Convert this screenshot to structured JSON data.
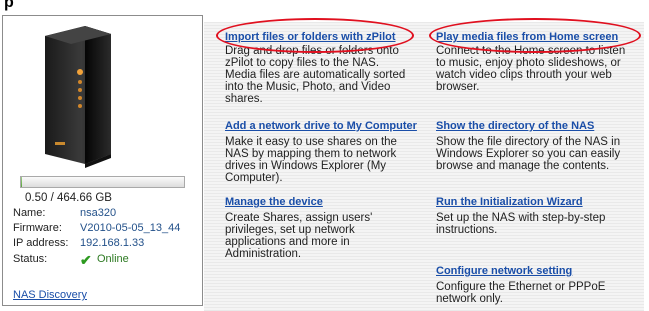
{
  "top_label": "p",
  "device": {
    "storage_text": "0.50 / 464.66 GB",
    "storage_used_fraction": 0.0011,
    "info": [
      {
        "label": "Name:",
        "value": "nsa320"
      },
      {
        "label": "Firmware:",
        "value": "V2010-05-05_13_44"
      },
      {
        "label": "IP address:",
        "value": "192.168.1.33"
      },
      {
        "label": "Status:",
        "value": "Online"
      }
    ],
    "discovery_link": "NAS Discovery"
  },
  "actions": {
    "import": {
      "title": "Import files or folders with zPilot",
      "desc": "Drag and drop files or folders onto zPilot to copy files to the NAS. Media files are automatically sorted into the Music, Photo, and Video shares."
    },
    "add_drive": {
      "title": "Add a network drive to My Computer",
      "desc": "Make it easy to use shares on the NAS by mapping them to network drives in Windows Explorer (My Computer)."
    },
    "manage": {
      "title": "Manage the device",
      "desc": "Create Shares, assign users' privileges, set up network applications and more in Administration."
    },
    "play_media": {
      "title": "Play media files from Home screen",
      "desc": "Connect to the Home screen to listen to music, enjoy photo slideshows, or watch video clips throuth your web browser."
    },
    "show_dir": {
      "title": "Show the directory of the NAS",
      "desc": "Show the file directory of the NAS in Windows Explorer so you can easily browse and manage the contents."
    },
    "wizard": {
      "title": "Run the Initialization Wizard",
      "desc": "Set up the NAS with step-by-step instructions."
    },
    "network": {
      "title": "Configure network setting",
      "desc": "Configure the Ethernet or PPPoE network only."
    }
  },
  "colors": {
    "link": "#1a4ea8",
    "highlight_oval": "#e0101f",
    "online": "#2d9a20"
  }
}
